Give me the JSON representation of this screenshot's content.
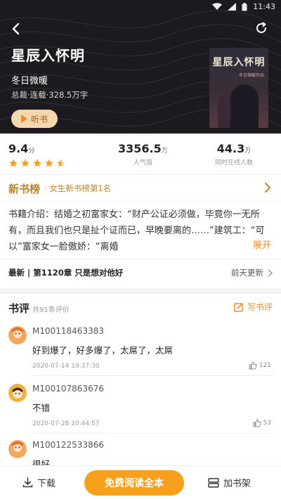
{
  "status_bar": {
    "time": "11:43"
  },
  "book": {
    "title": "星辰入怀明",
    "author": "冬日微暖",
    "meta": "总裁·连载·328.5万字",
    "listen_label": "听书",
    "cover_title": "星辰入怀明",
    "cover_subtitle": "冬日微暖作品"
  },
  "stats": {
    "rating_value": "9.4",
    "rating_unit": "分",
    "rating_stars": 4.5,
    "popularity_value": "3356.5",
    "popularity_unit": "万",
    "popularity_label": "人气值",
    "online_value": "44.3",
    "online_unit": "万",
    "online_label": "同时在线人数"
  },
  "ranking": {
    "title": "新书榜",
    "detail": "· 女生新书榜第1名"
  },
  "intro": {
    "text": "书籍介绍：结婚之初富家女：“财产公证必须做，毕竟你一无所有，而且我们也只是扯个证而已，早晚要离的……”建筑工：“可以”富家女一脸傲娇：“离婚",
    "expand_label": "展开"
  },
  "latest": {
    "chapter": "最新 | 第1120章 只是想对他好",
    "updated": "前天更新"
  },
  "reviews": {
    "title": "书评",
    "count": "共91条评价",
    "write_label": "写书评",
    "items": [
      {
        "user": "M100118463383",
        "text": "好到爆了，好多爆了，太屌了，太屌",
        "date": "2020-07-14 19:37:30",
        "likes": "121"
      },
      {
        "user": "M100107863676",
        "text": "不错",
        "date": "2020-07-28 20:44:57",
        "likes": "53"
      },
      {
        "user": "M100122533866",
        "text": "很好",
        "date": "",
        "likes": ""
      }
    ]
  },
  "bottom_bar": {
    "download_label": "下载",
    "read_label": "免费阅读全本",
    "shelf_label": "加书架"
  },
  "colors": {
    "accent": "#f08a2c",
    "rank_gold": "#b9852d",
    "read_button": "#f7a01c",
    "header_bg": "#1c1a1f"
  }
}
